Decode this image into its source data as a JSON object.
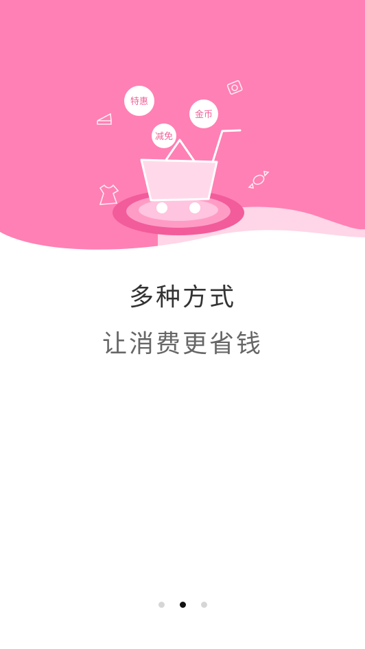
{
  "hero": {
    "tags": [
      "特惠",
      "金币",
      "减免"
    ],
    "illustration_icons": [
      "shopping-cart-icon",
      "cake-icon",
      "camera-icon",
      "candy-icon",
      "dress-icon"
    ],
    "colors": {
      "background": "#ff7eb3",
      "wave_light": "#ffd3e5",
      "accent": "#f1639a"
    }
  },
  "onboarding": {
    "title": "多种方式",
    "subtitle": "让消费更省钱"
  },
  "pager": {
    "total": 3,
    "active_index": 1
  }
}
